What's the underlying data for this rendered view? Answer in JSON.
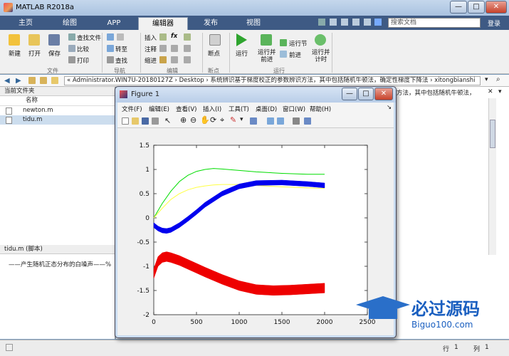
{
  "window": {
    "title": "MATLAB R2018a",
    "minimize": "—",
    "maximize": "□",
    "close": "✕"
  },
  "tabs": [
    "主页",
    "绘图",
    "APP",
    "编辑器",
    "发布",
    "视图"
  ],
  "search": {
    "placeholder": "搜索文档",
    "login": "登录"
  },
  "ribbon": {
    "file": {
      "new": "新建",
      "open": "打开",
      "save": "保存",
      "find_files": "查找文件",
      "compare": "比较",
      "print": "打印",
      "group": "文件"
    },
    "navigate": {
      "goto": "转至",
      "find": "查找",
      "group": "导航"
    },
    "edit": {
      "insert": "插入",
      "comment": "注释",
      "indent": "缩进",
      "fx": "fx",
      "group": "编辑"
    },
    "breakpoints": {
      "label": "断点",
      "group": "断点"
    },
    "run": {
      "run": "运行",
      "run_advance": "运行并\n前进",
      "run_section": "运行节",
      "advance": "前进",
      "run_time": "运行并\n计时",
      "group": "运行"
    }
  },
  "address": {
    "path": "« Administrator.WIN7U-20180127Z  ›  Desktop  ›  系统辨识基于梯度校正的参数辨识方法，其中包括随机牛顿法，确定性梯度下降法  ›  xitongbianshi"
  },
  "current_folder": {
    "title": "当前文件夹",
    "column": "名称",
    "files": [
      "newton.m",
      "tidu.m"
    ]
  },
  "details": {
    "title": "tidu.m  (脚本)",
    "text": "——产生随机正态分布的白噪声——%"
  },
  "editor_right_text": "方法，其中包括随机牛顿法，",
  "status": {
    "row_label": "行",
    "row": "1",
    "col_label": "列",
    "col": "1"
  },
  "figure": {
    "title": "Figure 1",
    "menu": [
      "文件(F)",
      "编辑(E)",
      "查看(V)",
      "插入(I)",
      "工具(T)",
      "桌面(D)",
      "窗口(W)",
      "帮助(H)"
    ]
  },
  "chart_data": {
    "type": "line",
    "title": "",
    "xlabel": "",
    "ylabel": "",
    "xlim": [
      0,
      2500
    ],
    "ylim": [
      -2,
      1.5
    ],
    "xticks": [
      "0",
      "500",
      "1000",
      "1500",
      "2000",
      "2500"
    ],
    "yticks": [
      "1.5",
      "1",
      "0.5",
      "0",
      "-0.5",
      "-1",
      "-1.5",
      "-2"
    ],
    "series": [
      {
        "color": "#00dd00",
        "x": [
          0,
          100,
          200,
          300,
          400,
          500,
          600,
          700,
          800,
          1000,
          1200,
          1500,
          1800,
          2000
        ],
        "values": [
          0,
          0.3,
          0.55,
          0.75,
          0.88,
          0.96,
          1.0,
          1.02,
          1.01,
          0.98,
          0.95,
          0.92,
          0.9,
          0.9
        ]
      },
      {
        "color": "#ffff44",
        "x": [
          0,
          100,
          200,
          300,
          400,
          500,
          600,
          700,
          800,
          1000,
          1200,
          1500,
          1800,
          2000
        ],
        "values": [
          0,
          0.2,
          0.38,
          0.5,
          0.58,
          0.63,
          0.66,
          0.68,
          0.69,
          0.69,
          0.67,
          0.64,
          0.62,
          0.61
        ]
      },
      {
        "color": "#0000ee",
        "x": [
          0,
          50,
          100,
          150,
          200,
          300,
          400,
          500,
          600,
          800,
          1000,
          1200,
          1500,
          1800,
          2000
        ],
        "values": [
          -0.15,
          -0.22,
          -0.26,
          -0.27,
          -0.25,
          -0.15,
          -0.02,
          0.12,
          0.27,
          0.5,
          0.65,
          0.72,
          0.73,
          0.7,
          0.67
        ],
        "band": 0.05
      },
      {
        "color": "#ee0000",
        "x": [
          0,
          50,
          100,
          150,
          200,
          300,
          400,
          500,
          600,
          800,
          1000,
          1200,
          1400,
          1600,
          1800,
          2000
        ],
        "values": [
          -1.15,
          -0.9,
          -0.82,
          -0.8,
          -0.82,
          -0.88,
          -0.96,
          -1.04,
          -1.12,
          -1.27,
          -1.4,
          -1.48,
          -1.5,
          -1.49,
          -1.47,
          -1.45
        ],
        "band": 0.1
      }
    ]
  },
  "watermark": {
    "text1": "必过源码",
    "text2": "Biguo100.com"
  }
}
